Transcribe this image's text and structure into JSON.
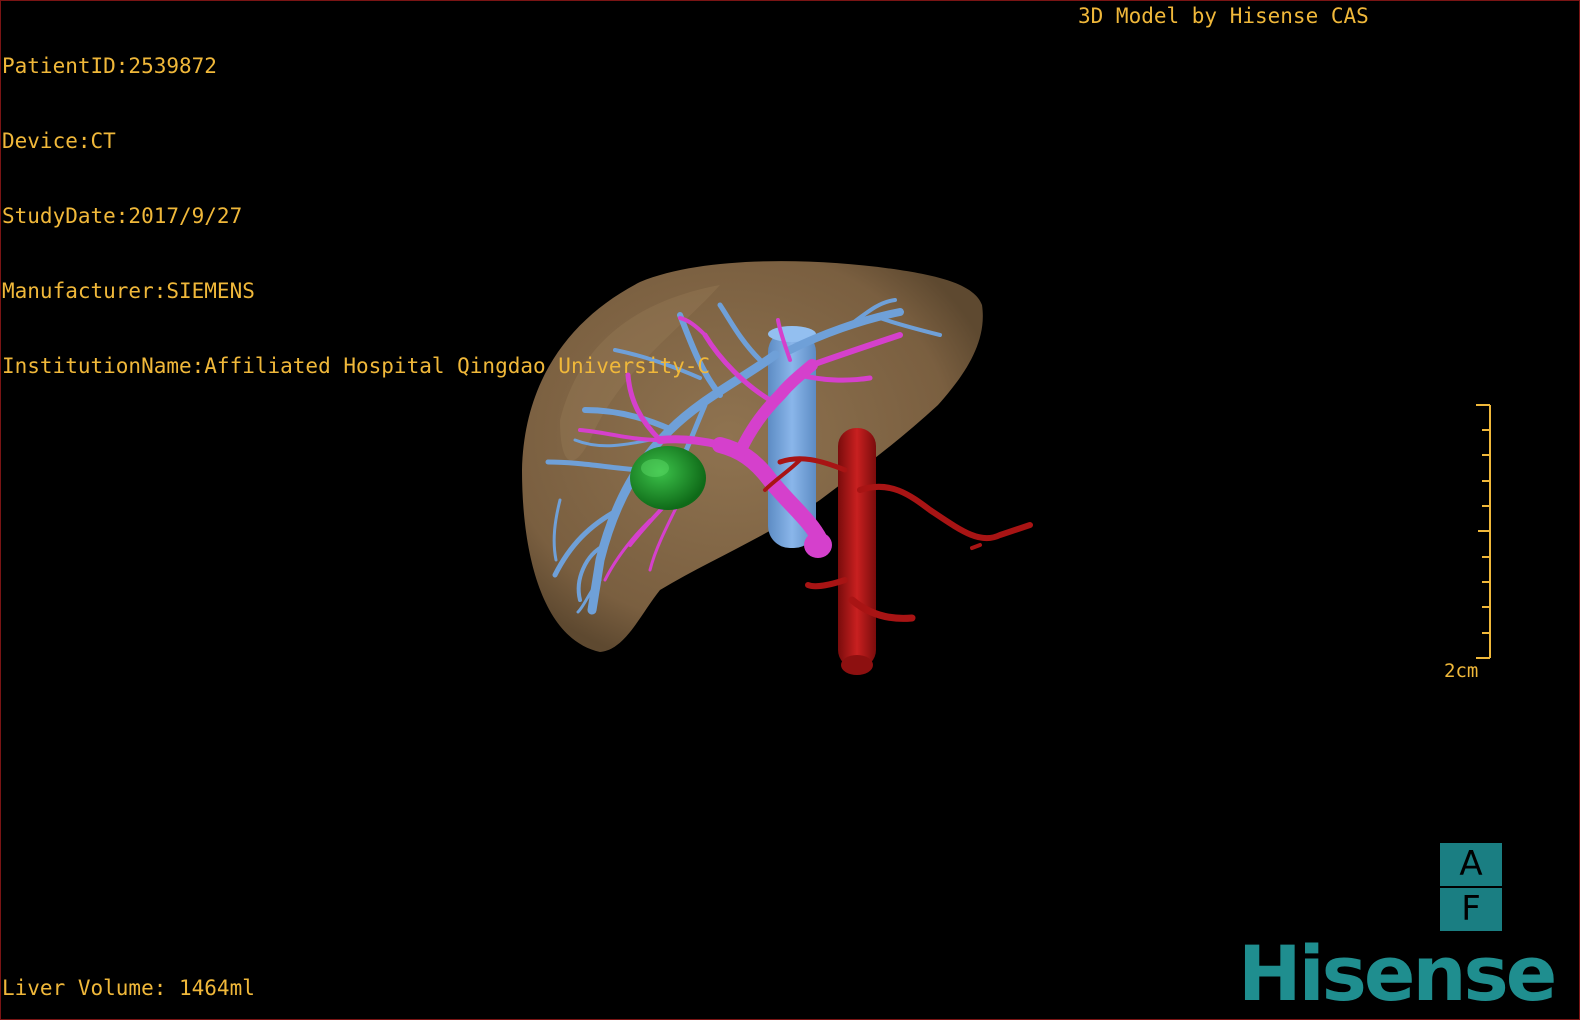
{
  "patient_info": {
    "patient_id": "PatientID:2539872",
    "device": "Device:CT",
    "study_date": "StudyDate:2017/9/27",
    "manufacturer": "Manufacturer:SIEMENS",
    "institution": "InstitutionName:Affiliated Hospital Qingdao University-C"
  },
  "title": "3D Model by Hisense CAS",
  "liver_volume": "Liver Volume: 1464ml",
  "scale_bar": {
    "label": "2cm"
  },
  "orientation": {
    "top": "A",
    "bottom": "F"
  },
  "logo": {
    "text": "Hisense"
  },
  "model_colors": {
    "liver": "#8a6d4c",
    "hepatic_vein": "#6fa0d8",
    "portal_vein": "#d540cc",
    "tumor": "#1f9a2a",
    "artery": "#a81414",
    "overlay_text": "#f0b83a",
    "logo": "#1f8e8f"
  }
}
